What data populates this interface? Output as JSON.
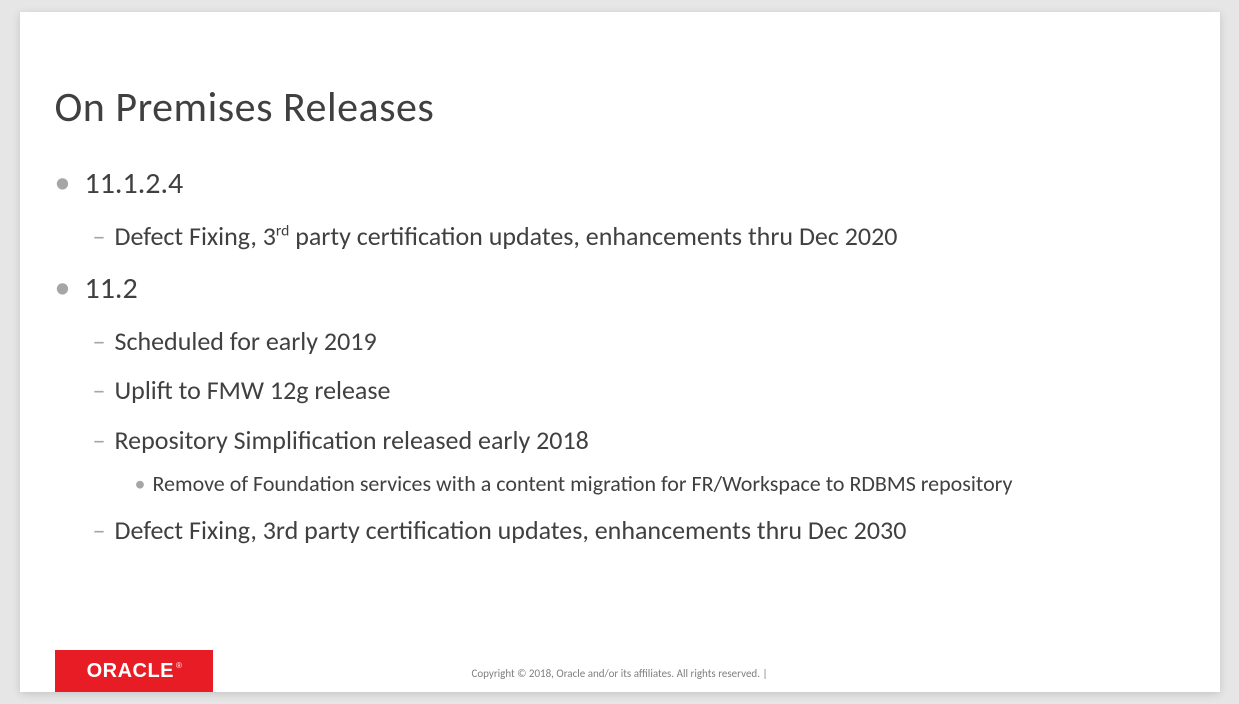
{
  "slide": {
    "title": "On Premises Releases",
    "bullets": {
      "v1": "11.1.2.4",
      "v1_sub1_pre": "Defect Fixing, 3",
      "v1_sub1_sup": "rd",
      "v1_sub1_post": " party certification updates, enhancements thru Dec 2020",
      "v2": "11.2",
      "v2_sub1": "Scheduled for early 2019",
      "v2_sub2": "Uplift to FMW 12g release",
      "v2_sub3": "Repository Simplification released early 2018",
      "v2_sub3_sub1": "Remove of Foundation services with a content migration for FR/Workspace to RDBMS repository",
      "v2_sub4": "Defect Fixing, 3rd party certification updates, enhancements thru Dec 2030"
    },
    "logo_text": "ORACLE",
    "logo_reg": "®",
    "copyright": "Copyright © 2018, Oracle and/or its affiliates. All rights reserved.  |"
  }
}
